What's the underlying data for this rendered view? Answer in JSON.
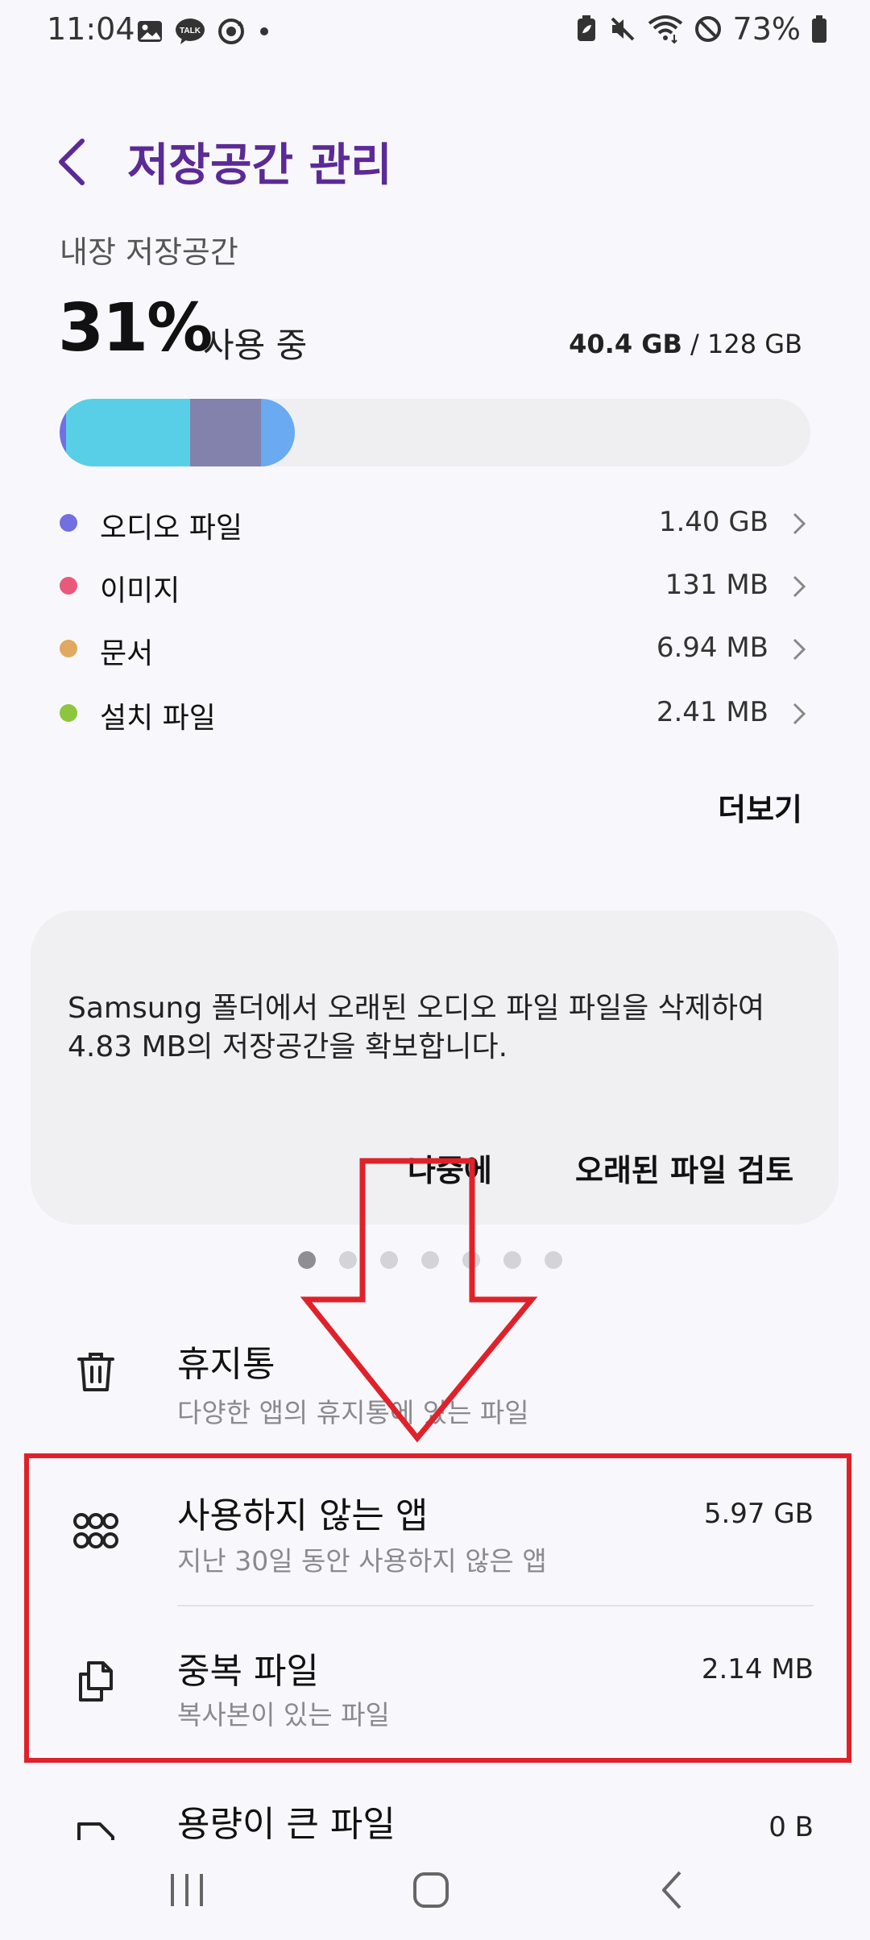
{
  "status": {
    "time": "11:04",
    "battery": "73%",
    "left_icons": [
      "gallery-icon",
      "kakaotalk-icon",
      "media-sync-icon",
      "dot-icon"
    ],
    "right_icons": [
      "battery-saver-icon",
      "mute-icon",
      "wifi-icon",
      "do-not-disturb-icon",
      "battery-icon"
    ]
  },
  "header": {
    "title": "저장공간 관리"
  },
  "storage": {
    "label": "내장 저장공간",
    "percent": "31%",
    "percent_suffix": "사용 중",
    "used": "40.4 GB",
    "separator": " / ",
    "total": "128 GB",
    "used_fraction": 0.31
  },
  "colors": {
    "accent": "#5b2a96",
    "audio": "#7070e0",
    "image": "#e85a7a",
    "document": "#e0a860",
    "install": "#8cc63e",
    "bar_cyan": "#58cfe6",
    "bar_slate": "#8282ad",
    "bar_blue": "#6aaaf0",
    "annotation": "#e0212a"
  },
  "categories": [
    {
      "label": "오디오 파일",
      "size": "1.40 GB",
      "color": "#7070e0"
    },
    {
      "label": "이미지",
      "size": "131 MB",
      "color": "#e85a7a"
    },
    {
      "label": "문서",
      "size": "6.94 MB",
      "color": "#e0a860"
    },
    {
      "label": "설치 파일",
      "size": "2.41 MB",
      "color": "#8cc63e"
    }
  ],
  "more_label": "더보기",
  "card": {
    "message": "Samsung 폴더에서 오래된 오디오 파일 파일을 삭제하여 4.83 MB의 저장공간을 확보합니다.",
    "later": "나중에",
    "review": "오래된 파일 검토"
  },
  "pager": {
    "count": 7,
    "active": 0
  },
  "list": [
    {
      "title": "휴지통",
      "subtitle": "다양한 앱의 휴지통에 있는 파일",
      "size": "",
      "icon": "trash-icon"
    },
    {
      "title": "사용하지 않는 앱",
      "subtitle": "지난 30일 동안 사용하지 않은 앱",
      "size": "5.97 GB",
      "icon": "apps-icon"
    },
    {
      "title": "중복 파일",
      "subtitle": "복사본이 있는 파일",
      "size": "2.14 MB",
      "icon": "duplicate-icon"
    },
    {
      "title": "용량이 큰 파일",
      "subtitle": "",
      "size": "0 B",
      "icon": "large-file-icon"
    }
  ],
  "nav": [
    "recents-icon",
    "home-icon",
    "back-icon"
  ]
}
